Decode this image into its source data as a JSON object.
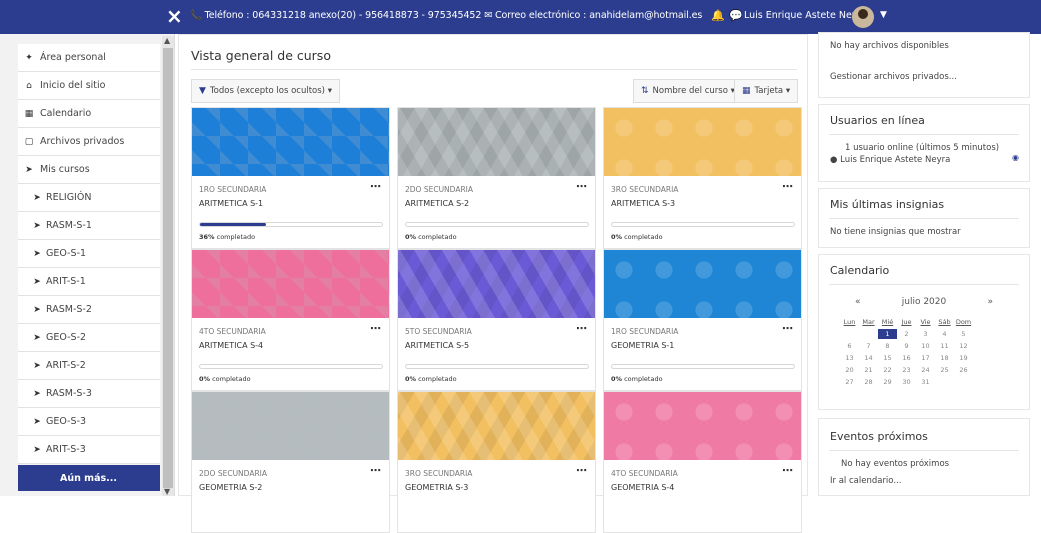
{
  "topbar": {
    "close_icon": "×",
    "info": "📞 Teléfono : 064331218 anexo(20) - 956418873 - 975345452 ✉ Correo electrónico : anahidelam@hotmail.es",
    "bell_icon": "🔔",
    "chat_icon": "💬",
    "user_name": "Luis Enrique Astete Neyra",
    "caret": "▼",
    "color": "#2c3d8f"
  },
  "nav": {
    "items": [
      {
        "icon": "✦",
        "label": "Área personal"
      },
      {
        "icon": "⌂",
        "label": "Inicio del sitio"
      },
      {
        "icon": "▦",
        "label": "Calendario"
      },
      {
        "icon": "▢",
        "label": "Archivos privados"
      },
      {
        "icon": "➤",
        "label": "Mis cursos"
      }
    ],
    "courses": [
      {
        "icon": "➤",
        "label": "RELIGIÓN"
      },
      {
        "icon": "➤",
        "label": "RASM-S-1"
      },
      {
        "icon": "➤",
        "label": "GEO-S-1"
      },
      {
        "icon": "➤",
        "label": "ARIT-S-1"
      },
      {
        "icon": "➤",
        "label": "RASM-S-2"
      },
      {
        "icon": "➤",
        "label": "GEO-S-2"
      },
      {
        "icon": "➤",
        "label": "ARIT-S-2"
      },
      {
        "icon": "➤",
        "label": "RASM-S-3"
      },
      {
        "icon": "➤",
        "label": "GEO-S-3"
      },
      {
        "icon": "➤",
        "label": "ARIT-S-3"
      }
    ],
    "more_label": "Aún más..."
  },
  "main": {
    "title": "Vista general de curso",
    "filter_label": "Todos (excepto los ocultos) ▾",
    "sort_label": "Nombre del curso ▾",
    "view_label": "Tarjeta ▾",
    "cards": [
      {
        "category": "1RO SECUNDARIA",
        "name": "ARITMETICA S-1",
        "progress": 36,
        "pct_num": "36%",
        "pct_text": " completado",
        "color": "#1e7fd8"
      },
      {
        "category": "2DO SECUNDARIA",
        "name": "ARITMETICA S-2",
        "progress": 0,
        "pct_num": "0%",
        "pct_text": " completado",
        "color": "#a9b1b3"
      },
      {
        "category": "3RO SECUNDARIA",
        "name": "ARITMETICA S-3",
        "progress": 0,
        "pct_num": "0%",
        "pct_text": " completado",
        "color": "#f2c061"
      },
      {
        "category": "4TO SECUNDARIA",
        "name": "ARITMETICA S-4",
        "progress": 0,
        "pct_num": "0%",
        "pct_text": " completado",
        "color": "#ee6f9b"
      },
      {
        "category": "5TO SECUNDARIA",
        "name": "ARITMETICA S-5",
        "progress": 0,
        "pct_num": "0%",
        "pct_text": " completado",
        "color": "#6a5ad6"
      },
      {
        "category": "1RO SECUNDARIA",
        "name": "GEOMETRIA S-1",
        "progress": 0,
        "pct_num": "0%",
        "pct_text": " completado",
        "color": "#1e86d4"
      },
      {
        "category": "2DO SECUNDARIA",
        "name": "GEOMETRIA S-2",
        "progress": null,
        "pct_num": "",
        "pct_text": "",
        "color": "#b5bcbf"
      },
      {
        "category": "3RO SECUNDARIA",
        "name": "GEOMETRIA S-3",
        "progress": null,
        "pct_num": "",
        "pct_text": "",
        "color": "#f2c061"
      },
      {
        "category": "4TO SECUNDARIA",
        "name": "GEOMETRIA S-4",
        "progress": null,
        "pct_num": "",
        "pct_text": "",
        "color": "#ef7aa3"
      }
    ]
  },
  "right": {
    "files_empty": "No hay archivos disponibles",
    "files_link": "Gestionar archivos privados...",
    "online_title": "Usuarios en línea",
    "online_count": "1 usuario online (últimos 5 minutos)",
    "online_user": "Luis Enrique Astete Neyra",
    "badges_title": "Mis últimas insignias",
    "badges_empty": "No tiene insignias que mostrar",
    "cal_title": "Calendario",
    "cal_prev": "«",
    "cal_month": "julio 2020",
    "cal_next": "»",
    "cal_dows": [
      "Lun",
      "Mar",
      "Mié",
      "Jue",
      "Vie",
      "Sáb",
      "Dom"
    ],
    "cal_days": [
      "",
      "",
      "1",
      "2",
      "3",
      "4",
      "5",
      "6",
      "7",
      "8",
      "9",
      "10",
      "11",
      "12",
      "13",
      "14",
      "15",
      "16",
      "17",
      "18",
      "19",
      "20",
      "21",
      "22",
      "23",
      "24",
      "25",
      "26",
      "27",
      "28",
      "29",
      "30",
      "31",
      "",
      "",
      ""
    ],
    "events_title": "Eventos próximos",
    "events_empty": "No hay eventos próximos",
    "events_link": "Ir al calendario..."
  }
}
